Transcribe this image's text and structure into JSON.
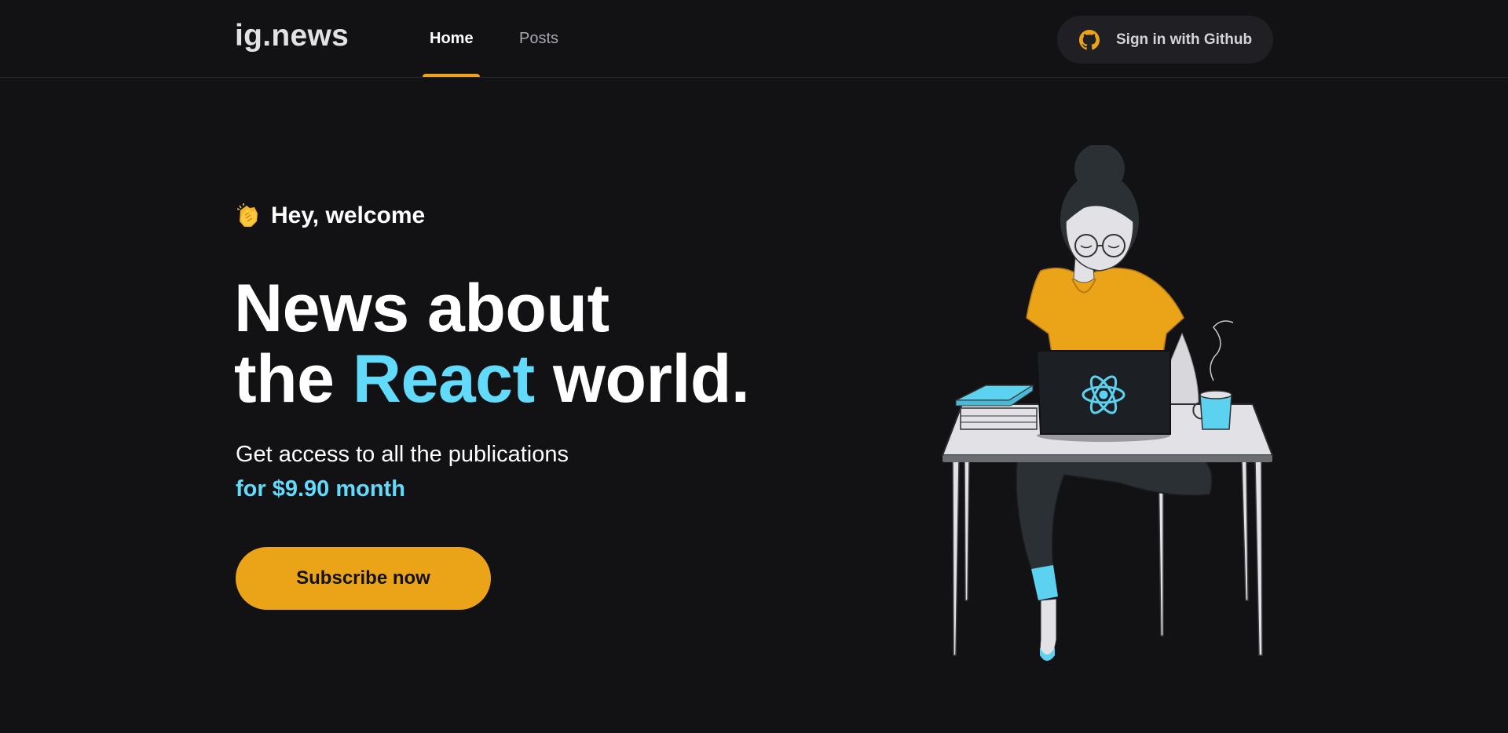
{
  "header": {
    "logo": "ig.news",
    "nav": [
      {
        "label": "Home",
        "active": true
      },
      {
        "label": "Posts",
        "active": false
      }
    ],
    "signin_label": "Sign in with Github",
    "signin_icon": "github-icon",
    "accent_color": "#eba417"
  },
  "hero": {
    "greeting": "Hey, welcome",
    "greeting_icon": "clapping-hands-icon",
    "headline_line1": "News about",
    "headline_the": "the",
    "headline_accent": "React",
    "headline_world": "world.",
    "subtitle": "Get access to all the publications",
    "price_text": "for $9.90 month",
    "cta_label": "Subscribe now",
    "accent_blue": "#61dafb"
  }
}
